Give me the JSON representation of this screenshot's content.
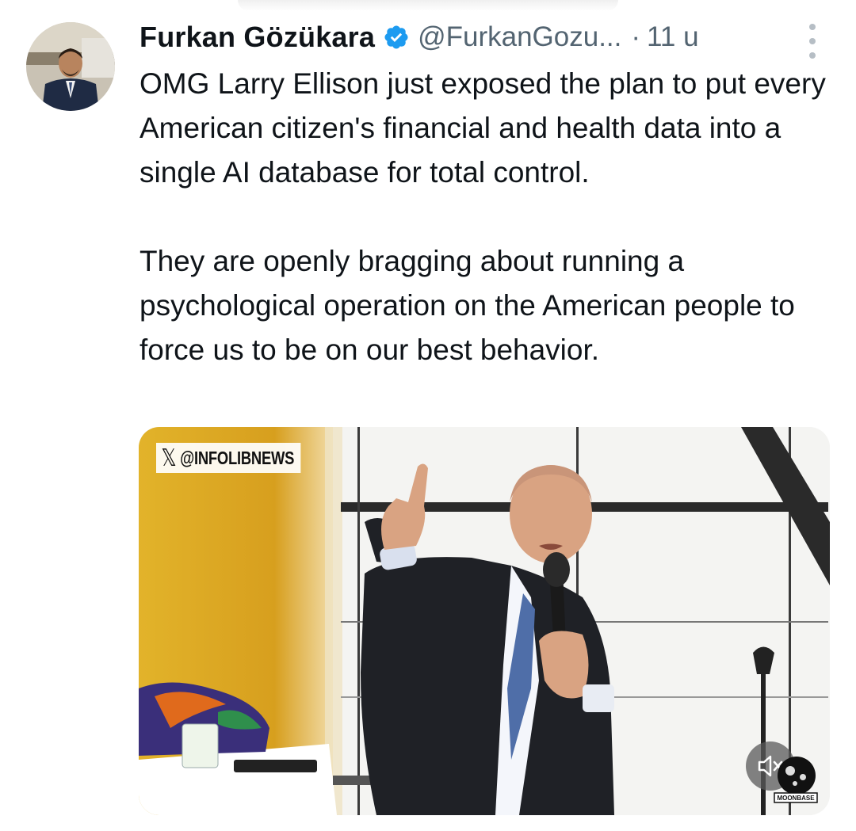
{
  "post": {
    "author_name": "Furkan Gözükara",
    "handle": "@FurkanGozu...",
    "separator": "·",
    "time": "11 u",
    "paragraphs": [
      "OMG Larry Ellison just exposed the plan to put every American citizen's financial and health data into a single AI database for total control.",
      "They are openly bragging about running a psychological operation on the American people to force us to be on our best behavior."
    ]
  },
  "media": {
    "watermark_logo": "𝕏",
    "watermark_text": "@INFOLIBNEWS",
    "badge_text": "MOONBASE",
    "mute_icon": "volume-muted-icon"
  },
  "colors": {
    "verified": "#1d9bf0",
    "text": "#0f1419",
    "secondary": "#536471"
  }
}
